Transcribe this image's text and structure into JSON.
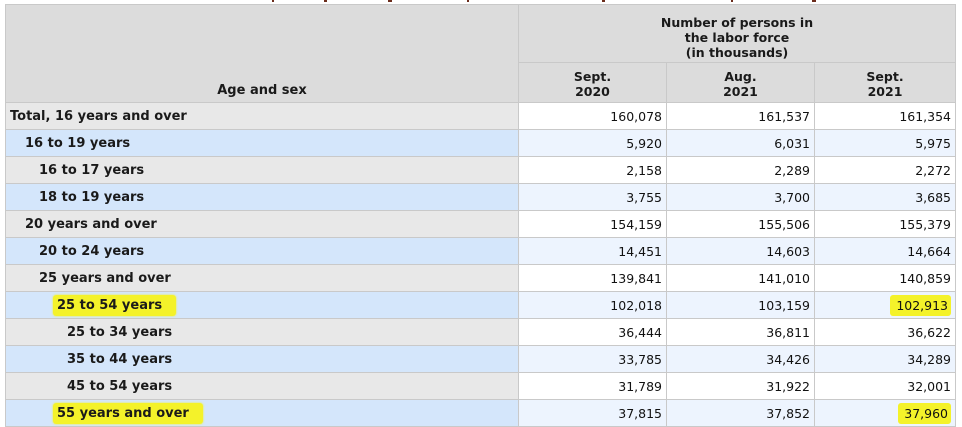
{
  "header": {
    "group_label_line1": "Number of persons in",
    "group_label_line2": "the labor force",
    "group_label_line3": "(in thousands)",
    "row_label": "Age and sex",
    "periods": [
      {
        "line1": "Sept.",
        "line2": "2020"
      },
      {
        "line1": "Aug.",
        "line2": "2021"
      },
      {
        "line1": "Sept.",
        "line2": "2021"
      }
    ]
  },
  "rows": [
    {
      "label": "Total, 16 years and over",
      "values": [
        "160,078",
        "161,537",
        "161,354"
      ]
    },
    {
      "label": "16 to 19 years",
      "values": [
        "5,920",
        "6,031",
        "5,975"
      ]
    },
    {
      "label": "16 to 17 years",
      "values": [
        "2,158",
        "2,289",
        "2,272"
      ]
    },
    {
      "label": "18 to 19 years",
      "values": [
        "3,755",
        "3,700",
        "3,685"
      ]
    },
    {
      "label": "20 years and over",
      "values": [
        "154,159",
        "155,506",
        "155,379"
      ]
    },
    {
      "label": "20 to 24 years",
      "values": [
        "14,451",
        "14,603",
        "14,664"
      ]
    },
    {
      "label": "25 years and over",
      "values": [
        "139,841",
        "141,010",
        "140,859"
      ]
    },
    {
      "label": "25 to 54 years",
      "values": [
        "102,018",
        "103,159",
        "102,913"
      ]
    },
    {
      "label": "25 to 34 years",
      "values": [
        "36,444",
        "36,811",
        "36,622"
      ]
    },
    {
      "label": "35 to 44 years",
      "values": [
        "33,785",
        "34,426",
        "34,289"
      ]
    },
    {
      "label": "45 to 54 years",
      "values": [
        "31,789",
        "31,922",
        "32,001"
      ]
    },
    {
      "label": "55 years and over",
      "values": [
        "37,815",
        "37,852",
        "37,960"
      ]
    }
  ],
  "highlight_color": "#f4f22a"
}
